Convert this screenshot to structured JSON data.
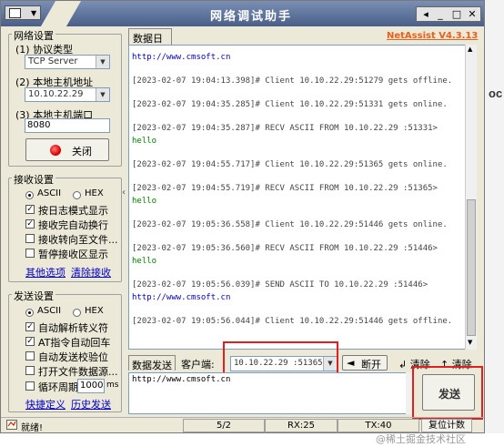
{
  "window": {
    "title": "网络调试助手"
  },
  "background": {
    "side_text": "oc"
  },
  "left": {
    "net_settings": {
      "label": "网络设置",
      "protocol_label": "(1) 协议类型",
      "protocol_value": "TCP Server",
      "host_ip_label": "(2) 本地主机地址",
      "host_ip_value": "10.10.22.29",
      "port_label": "(3) 本地主机端口",
      "port_value": "8080",
      "close_button": "关闭"
    },
    "recv_settings": {
      "label": "接收设置",
      "radio_ascii": "ASCII",
      "radio_hex": "HEX",
      "opt_log_mode": "按日志模式显示",
      "opt_auto_wrap": "接收完自动换行",
      "opt_to_file": "接收转向至文件...",
      "opt_pause": "暂停接收区显示",
      "link_save": "其他选项",
      "link_clear": "清除接收"
    },
    "send_settings": {
      "label": "发送设置",
      "radio_ascii": "ASCII",
      "radio_hex": "HEX",
      "opt_escape": "自动解析转义符",
      "opt_at": "AT指令自动回车",
      "opt_checksum": "自动发送校验位",
      "opt_file": "打开文件数据源...",
      "opt_loop": "循环周期",
      "loop_ms": "1000",
      "loop_unit": "ms",
      "link_shortcut": "快捷定义",
      "link_history": "历史发送"
    }
  },
  "log": {
    "tab_label": "数据日志",
    "brand": "NetAssist V4.3.13",
    "lines": [
      {
        "text": "http://www.cmsoft.cn",
        "kind": "url"
      },
      {
        "text": "[2023-02-07 19:04:13.398]# Client 10.10.22.29:51279 gets offline.",
        "kind": "gray"
      },
      {
        "text": "[2023-02-07 19:04:35.285]# Client 10.10.22.29:51331 gets online.",
        "kind": "gray"
      },
      {
        "text": "[2023-02-07 19:04:35.287]# RECV ASCII FROM 10.10.22.29 :51331>",
        "kind": "gray"
      },
      {
        "text": "hello",
        "kind": "green"
      },
      {
        "text": "[2023-02-07 19:04:55.717]# Client 10.10.22.29:51365 gets online.",
        "kind": "gray"
      },
      {
        "text": "[2023-02-07 19:04:55.719]# RECV ASCII FROM 10.10.22.29 :51365>",
        "kind": "gray"
      },
      {
        "text": "hello",
        "kind": "green"
      },
      {
        "text": "[2023-02-07 19:05:36.558]# Client 10.10.22.29:51446 gets online.",
        "kind": "gray"
      },
      {
        "text": "[2023-02-07 19:05:36.560]# RECV ASCII FROM 10.10.22.29 :51446>",
        "kind": "gray"
      },
      {
        "text": "hello",
        "kind": "green"
      },
      {
        "text": "[2023-02-07 19:05:56.039]# SEND ASCII TO 10.10.22.29 :51446>",
        "kind": "gray"
      },
      {
        "text": "http://www.cmsoft.cn",
        "kind": "url"
      },
      {
        "text": "[2023-02-07 19:05:56.044]# Client 10.10.22.29:51446 gets offline.",
        "kind": "gray"
      }
    ]
  },
  "send": {
    "tab_label": "数据发送",
    "client_label": "客户端:",
    "client_value": "10.10.22.29 :51365",
    "disconnect": "断开",
    "clear_left": "清除",
    "clear_right": "清除",
    "content": "http://www.cmsoft.cn",
    "send_button": "发送"
  },
  "status": {
    "ready": "就绪!",
    "page": "5/2",
    "rx": "RX:25",
    "tx": "TX:40",
    "reset": "复位计数"
  },
  "watermark": "@稀土掘金技术社区",
  "colors": {
    "accent_red": "#e02020",
    "brand_orange": "#e8601c",
    "link_blue": "#0000cc",
    "recv_green": "#008000"
  }
}
